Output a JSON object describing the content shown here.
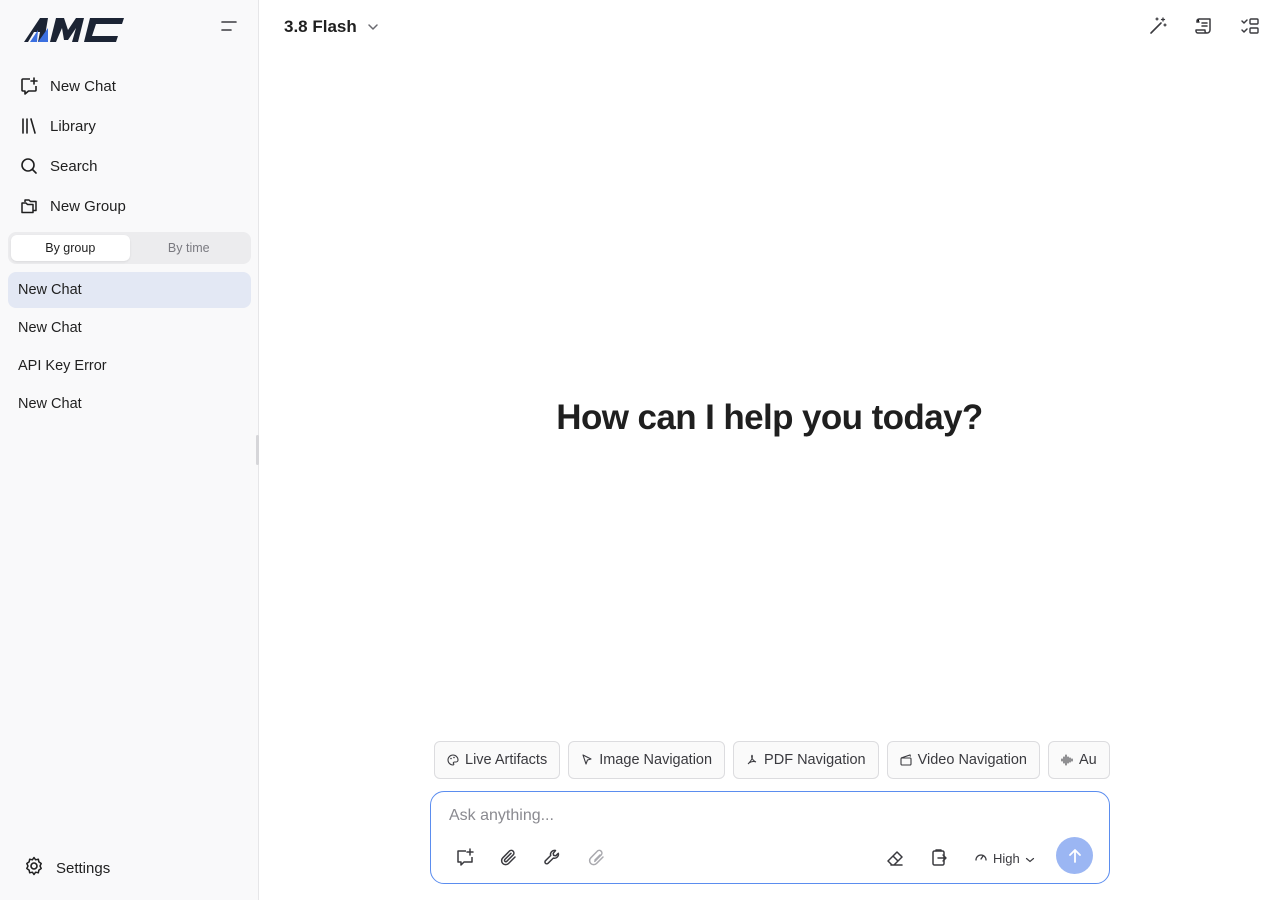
{
  "sidebar": {
    "logo_text": "AMC",
    "nav": [
      {
        "label": "New Chat",
        "icon": "new-chat-icon"
      },
      {
        "label": "Library",
        "icon": "library-icon"
      },
      {
        "label": "Search",
        "icon": "search-icon"
      },
      {
        "label": "New Group",
        "icon": "folder-plus-icon"
      }
    ],
    "segments": [
      "By group",
      "By time"
    ],
    "active_segment": "By group",
    "chats": [
      "New Chat",
      "New Chat",
      "API Key Error",
      "New Chat"
    ],
    "active_chat_index": 0,
    "settings_label": "Settings"
  },
  "header": {
    "model": "3.8 Flash"
  },
  "main": {
    "greeting": "How can I help you today?"
  },
  "chips": [
    {
      "label": "Live Artifacts",
      "icon": "palette-icon"
    },
    {
      "label": "Image Navigation",
      "icon": "cursor-icon"
    },
    {
      "label": "PDF Navigation",
      "icon": "pdf-icon"
    },
    {
      "label": "Video Navigation",
      "icon": "clapperboard-icon"
    },
    {
      "label": "Au",
      "icon": "audio-wave-icon"
    }
  ],
  "composer": {
    "placeholder": "Ask anything...",
    "effort": "High"
  },
  "colors": {
    "accent": "#5b8def",
    "send_bg": "#9bb6f3",
    "active_chat_bg": "#e3e8f4",
    "logo_blue": "#3b6fe0",
    "logo_dark": "#1c2434"
  }
}
